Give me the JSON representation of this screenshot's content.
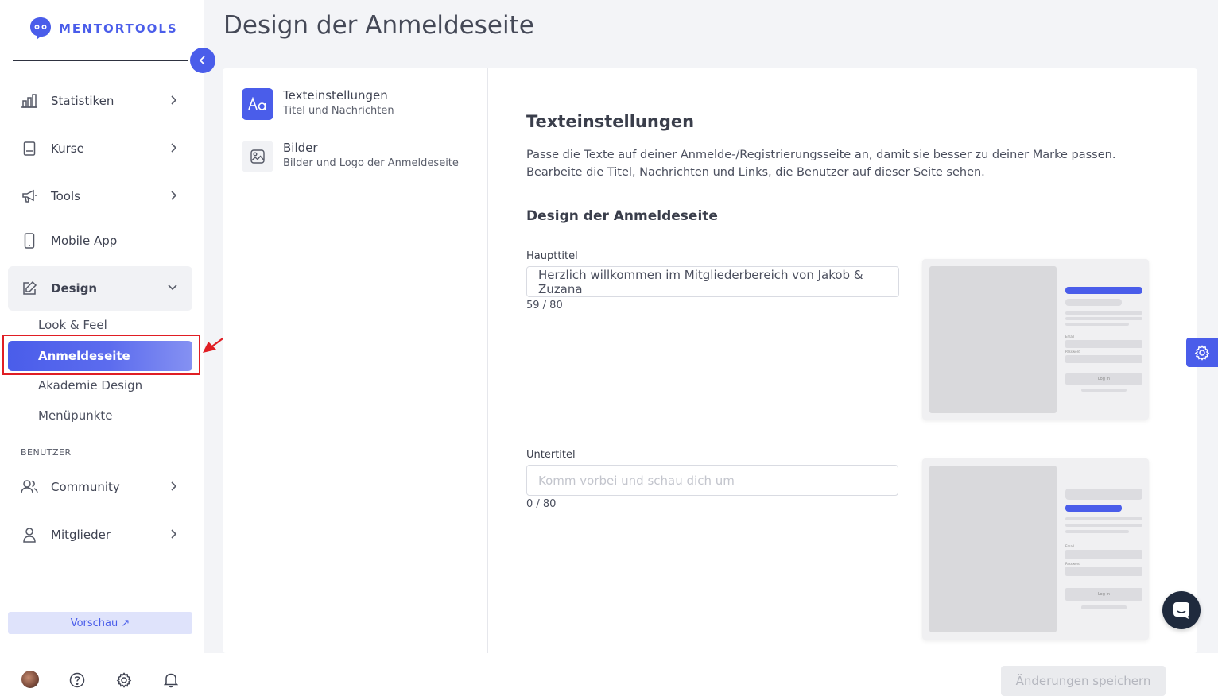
{
  "brand": {
    "name": "MENTORTOOLS"
  },
  "sidebar": {
    "items": [
      {
        "label": "Statistiken",
        "icon": "bar-chart-icon"
      },
      {
        "label": "Kurse",
        "icon": "book-icon"
      },
      {
        "label": "Tools",
        "icon": "megaphone-icon"
      },
      {
        "label": "Mobile App",
        "icon": "smartphone-icon"
      },
      {
        "label": "Design",
        "icon": "edit-icon"
      }
    ],
    "design_sub": [
      "Look & Feel",
      "Anmeldeseite",
      "Akademie Design",
      "Menüpunkte"
    ],
    "section_users": "BENUTZER",
    "user_items": [
      {
        "label": "Community",
        "icon": "users-icon"
      },
      {
        "label": "Mitglieder",
        "icon": "user-icon"
      }
    ],
    "preview_label": "Vorschau ↗"
  },
  "page": {
    "title": "Design der Anmeldeseite"
  },
  "subnav": [
    {
      "title": "Texteinstellungen",
      "subtitle": "Titel und Nachrichten",
      "icon": "text-icon"
    },
    {
      "title": "Bilder",
      "subtitle": "Bilder und Logo der Anmeldeseite",
      "icon": "image-icon"
    }
  ],
  "content": {
    "heading": "Texteinstellungen",
    "description": "Passe die Texte auf deiner Anmelde-/Registrierungsseite an, damit sie besser zu deiner Marke passen. Bearbeite die Titel, Nachrichten und Links, die Benutzer auf dieser Seite sehen.",
    "section_heading": "Design der Anmeldeseite",
    "fields": [
      {
        "label": "Haupttitel",
        "value": "Herzlich willkommen im Mitgliederbereich von Jakob & Zuzana",
        "placeholder": "",
        "counter": "59 / 80"
      },
      {
        "label": "Untertitel",
        "value": "",
        "placeholder": "Komm vorbei und schau dich um",
        "counter": "0 / 80"
      }
    ],
    "mock_labels": {
      "email": "Email",
      "password": "Password",
      "login": "Log in"
    }
  },
  "footer": {
    "save_label": "Änderungen speichern"
  },
  "colors": {
    "accent": "#4a5dea",
    "highlight": "#e01e24"
  }
}
